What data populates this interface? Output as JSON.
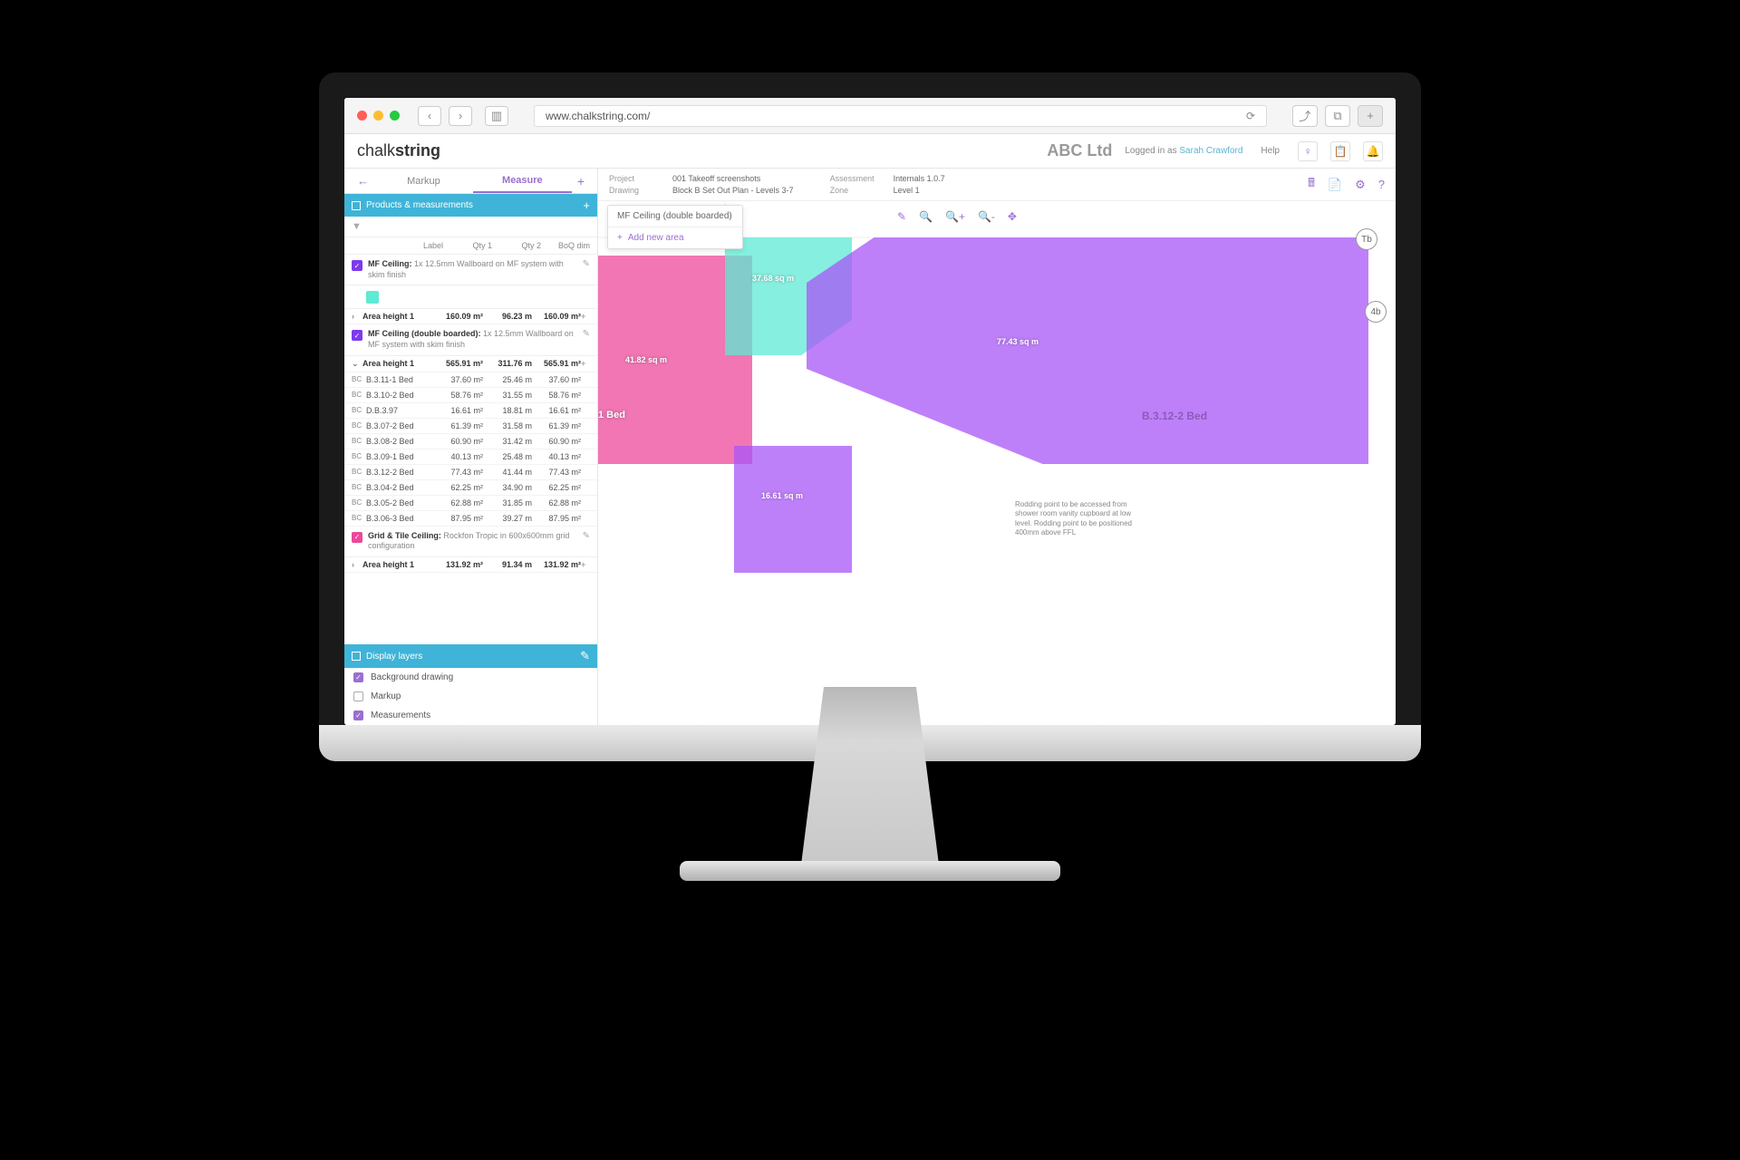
{
  "browser": {
    "url": "www.chalkstring.com/"
  },
  "header": {
    "logo_light": "chalk",
    "logo_bold": "string",
    "company": "ABC Ltd",
    "login_prefix": "Logged in as ",
    "login_user": "Sarah Crawford",
    "help": "Help"
  },
  "tabs": {
    "markup": "Markup",
    "measure": "Measure"
  },
  "sections": {
    "products": "Products & measurements",
    "layers": "Display layers"
  },
  "columns": {
    "label": "Label",
    "qty1": "Qty 1",
    "qty2": "Qty 2",
    "boq": "BoQ dim"
  },
  "products": [
    {
      "color": "#7c3aed",
      "name": "MF Ceiling:",
      "desc": "1x 12.5mm Wallboard on MF system with skim finish"
    },
    {
      "color": "#7c3aed",
      "name": "MF Ceiling (double boarded):",
      "desc": "1x 12.5mm Wallboard on MF system with skim finish"
    },
    {
      "color": "#ec4899",
      "name": "Grid & Tile Ceiling:",
      "desc": "Rockfon Tropic in 600x600mm grid configuration"
    }
  ],
  "area1": {
    "label": "Area height 1",
    "q1": "160.09 m²",
    "q2": "96.23 m",
    "q3": "160.09 m²"
  },
  "area2": {
    "label": "Area height 1",
    "q1": "565.91 m²",
    "q2": "311.76 m",
    "q3": "565.91 m²"
  },
  "area3": {
    "label": "Area height 1",
    "q1": "131.92 m²",
    "q2": "91.34 m",
    "q3": "131.92 m²"
  },
  "rows": [
    {
      "t": "BC",
      "l": "B.3.11-1 Bed",
      "a": "37.60 m²",
      "b": "25.46 m",
      "c": "37.60 m²"
    },
    {
      "t": "BC",
      "l": "B.3.10-2 Bed",
      "a": "58.76 m²",
      "b": "31.55 m",
      "c": "58.76 m²"
    },
    {
      "t": "BC",
      "l": "D.B.3.97",
      "a": "16.61 m²",
      "b": "18.81 m",
      "c": "16.61 m²"
    },
    {
      "t": "BC",
      "l": "B.3.07-2 Bed",
      "a": "61.39 m²",
      "b": "31.58 m",
      "c": "61.39 m²"
    },
    {
      "t": "BC",
      "l": "B.3.08-2 Bed",
      "a": "60.90 m²",
      "b": "31.42 m",
      "c": "60.90 m²"
    },
    {
      "t": "BC",
      "l": "B.3.09-1 Bed",
      "a": "40.13 m²",
      "b": "25.48 m",
      "c": "40.13 m²"
    },
    {
      "t": "BC",
      "l": "B.3.12-2 Bed",
      "a": "77.43 m²",
      "b": "41.44 m",
      "c": "77.43 m²"
    },
    {
      "t": "BC",
      "l": "B.3.04-2 Bed",
      "a": "62.25 m²",
      "b": "34.90 m",
      "c": "62.25 m²"
    },
    {
      "t": "BC",
      "l": "B.3.05-2 Bed",
      "a": "62.88 m²",
      "b": "31.85 m",
      "c": "62.88 m²"
    },
    {
      "t": "BC",
      "l": "B.3.06-3 Bed",
      "a": "87.95 m²",
      "b": "39.27 m",
      "c": "87.95 m²"
    }
  ],
  "layers": [
    {
      "label": "Background drawing",
      "on": true
    },
    {
      "label": "Markup",
      "on": false
    },
    {
      "label": "Measurements",
      "on": true
    }
  ],
  "info": {
    "project_k": "Project",
    "project_v": "001 Takeoff screenshots",
    "drawing_k": "Drawing",
    "drawing_v": "Block B Set Out Plan - Levels 3-7",
    "assess_k": "Assessment",
    "assess_v": "Internals 1.0.7",
    "zone_k": "Zone",
    "zone_v": "Level 1"
  },
  "popup": {
    "title": "MF Ceiling (double boarded)",
    "action": "Add new area"
  },
  "plan": {
    "pink_area": "41.82 sq m",
    "teal_area": "37.68 sq m",
    "purple_area1": "77.43 sq m",
    "purple_area2": "16.61 sq m",
    "room1": "B.3.12-2 Bed",
    "bed1": "1 Bed",
    "grid_tb": "Tb",
    "grid_4b": "4b",
    "note": "Rodding point to be accessed from shower room vanity cupboard at low level. Rodding point to be positioned 400mm above FFL"
  }
}
